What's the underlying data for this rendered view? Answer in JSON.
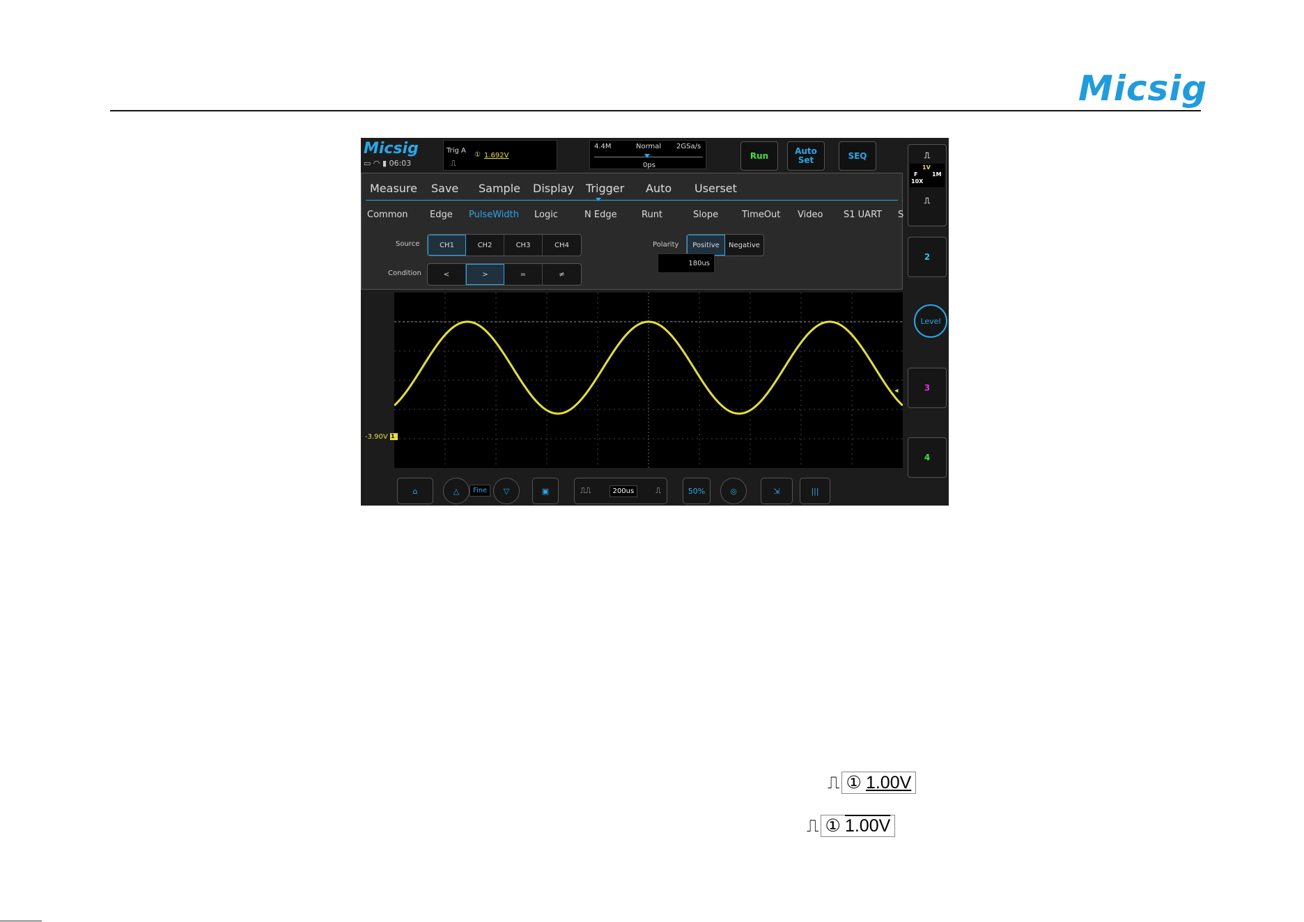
{
  "brand": "Micsig",
  "scope": {
    "logo": "Micsig",
    "clock": "06:03",
    "trigger": {
      "label": "Trig  A",
      "channel_mark": "①",
      "level": "1.692V"
    },
    "timebar": {
      "memory": "4.4M",
      "mode": "Normal",
      "rate": "2GSa/s",
      "offset": "0ps"
    },
    "buttons": {
      "run": "Run",
      "auto_set_line1": "Auto",
      "auto_set_line2": "Set",
      "seq": "SEQ"
    },
    "menu": [
      "Measure",
      "Save",
      "Sample",
      "Display",
      "Trigger",
      "Auto",
      "Userset"
    ],
    "submenu": [
      "Common",
      "Edge",
      "PulseWidth",
      "Logic",
      "N Edge",
      "Runt",
      "Slope",
      "TimeOut",
      "Video",
      "S1 UART",
      "S"
    ],
    "source": {
      "label": "Source",
      "options": [
        "CH1",
        "CH2",
        "CH3",
        "CH4"
      ],
      "selected": "CH1"
    },
    "condition": {
      "label": "Condition",
      "options": [
        "<",
        ">",
        "=",
        "≠"
      ],
      "selected": ">"
    },
    "polarity": {
      "label": "Polarity",
      "options": [
        "Positive",
        "Negative"
      ],
      "selected": "Positive"
    },
    "width_value": "180us",
    "ch1": {
      "scale": "1V",
      "coupling": "F",
      "impedance": "1M",
      "probe": "10X",
      "offset": "-3.90V",
      "marker": "1"
    },
    "side": {
      "level": "Level",
      "ch2": "2",
      "ch3": "3",
      "ch4": "4"
    },
    "bottom": {
      "fine": "Fine",
      "timebase": "200us",
      "pct": "50%"
    }
  },
  "legend": [
    {
      "channel": "①",
      "value": "1.00V"
    },
    {
      "channel": "①",
      "value": "1.00V"
    }
  ],
  "colors": {
    "brand_blue": "#1f9be0",
    "ch1": "#e8e030",
    "ch2": "#28c8e8",
    "ch3": "#e030e0",
    "ch4": "#3fe03f",
    "run": "#3fe03f"
  }
}
